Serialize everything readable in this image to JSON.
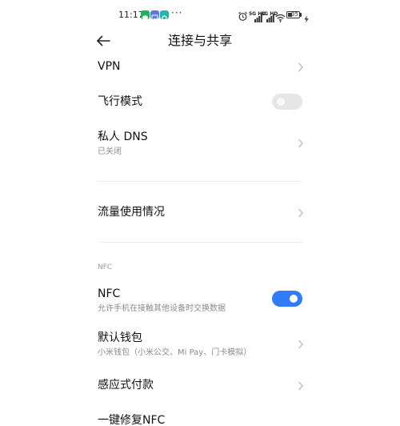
{
  "status_bar": {
    "time": "11:17",
    "more_dots": "···",
    "signal_labels": [
      "5G HD",
      "4G HD"
    ],
    "battery_level": "35"
  },
  "header": {
    "title": "连接与共享"
  },
  "rows": {
    "vpn": {
      "title": "VPN"
    },
    "airplane": {
      "title": "飞行模式",
      "enabled": false
    },
    "private_dns": {
      "title": "私人 DNS",
      "subtitle": "已关闭"
    },
    "data_usage": {
      "title": "流量使用情况"
    },
    "nfc_section": {
      "label": "NFC"
    },
    "nfc": {
      "title": "NFC",
      "subtitle": "允许手机在接触其他设备时交换数据",
      "enabled": true
    },
    "default_wallet": {
      "title": "默认钱包",
      "subtitle": "小米钱包（小米公交、Mi Pay、门卡模拟）"
    },
    "tap_to_pay": {
      "title": "感应式付款"
    },
    "nfc_repair": {
      "title": "一键修复NFC"
    }
  },
  "colors": {
    "accent": "#2f7cf6",
    "toggle_off": "#e6e6e6",
    "subtitle": "#8a8a8a",
    "divider": "#ececec",
    "chevron": "#b5b5b5"
  }
}
